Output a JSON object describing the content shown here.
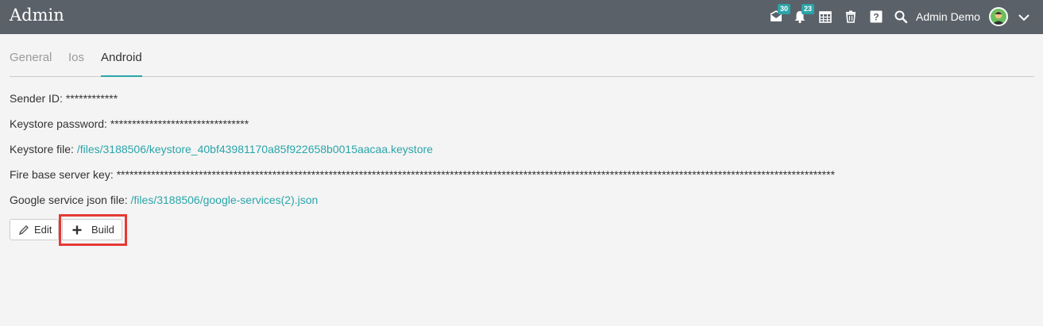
{
  "header": {
    "title": "Admin",
    "messages_badge": "30",
    "notifications_badge": "23",
    "user_name": "Admin Demo"
  },
  "tabs": [
    {
      "label": "General",
      "active": false
    },
    {
      "label": "Ios",
      "active": false
    },
    {
      "label": "Android",
      "active": true
    }
  ],
  "fields": {
    "sender_id": {
      "label": "Sender ID:",
      "value": "************"
    },
    "keystore_password": {
      "label": "Keystore password:",
      "value": "********************************"
    },
    "keystore_file": {
      "label": "Keystore file:",
      "value": "/files/3188506/keystore_40bf43981170a85f922658b0015aacaa.keystore"
    },
    "firebase_key": {
      "label": "Fire base server key:",
      "value": "**********************************************************************************************************************************************************************"
    },
    "google_json": {
      "label": "Google service json file:",
      "value": "/files/3188506/google-services(2).json"
    }
  },
  "actions": {
    "edit_label": "Edit",
    "build_label": "Build"
  },
  "colors": {
    "topbar": "#5a6169",
    "accent": "#2aa5a9",
    "highlight": "#e53935"
  }
}
